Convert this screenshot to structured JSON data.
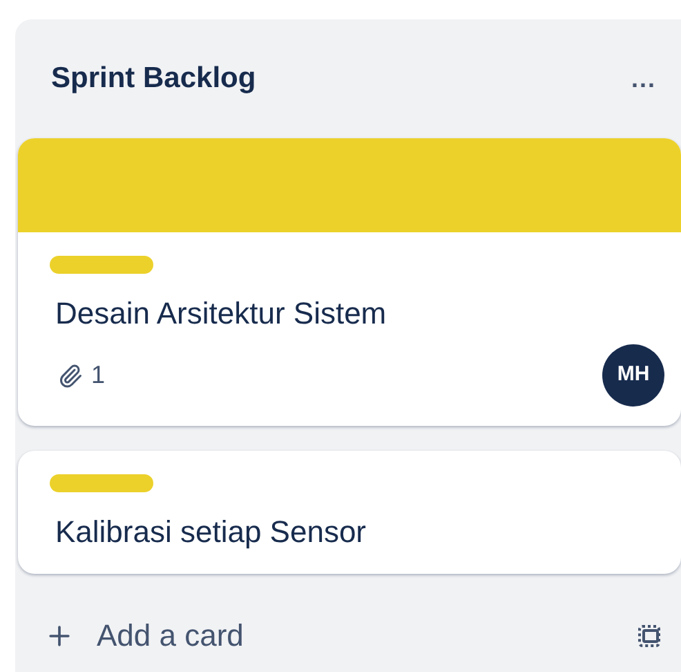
{
  "list": {
    "title": "Sprint Backlog",
    "menu_label": "...",
    "cards": [
      {
        "cover": {
          "color": "#ecd12a"
        },
        "labels": [
          {
            "color": "#ecd12a"
          }
        ],
        "title": "Desain Arsitektur Sistem",
        "attachments": "1",
        "member": "MH"
      },
      {
        "labels": [
          {
            "color": "#ecd12a"
          }
        ],
        "title": "Kalibrasi setiap Sensor"
      }
    ],
    "add_card": "Add a card"
  }
}
